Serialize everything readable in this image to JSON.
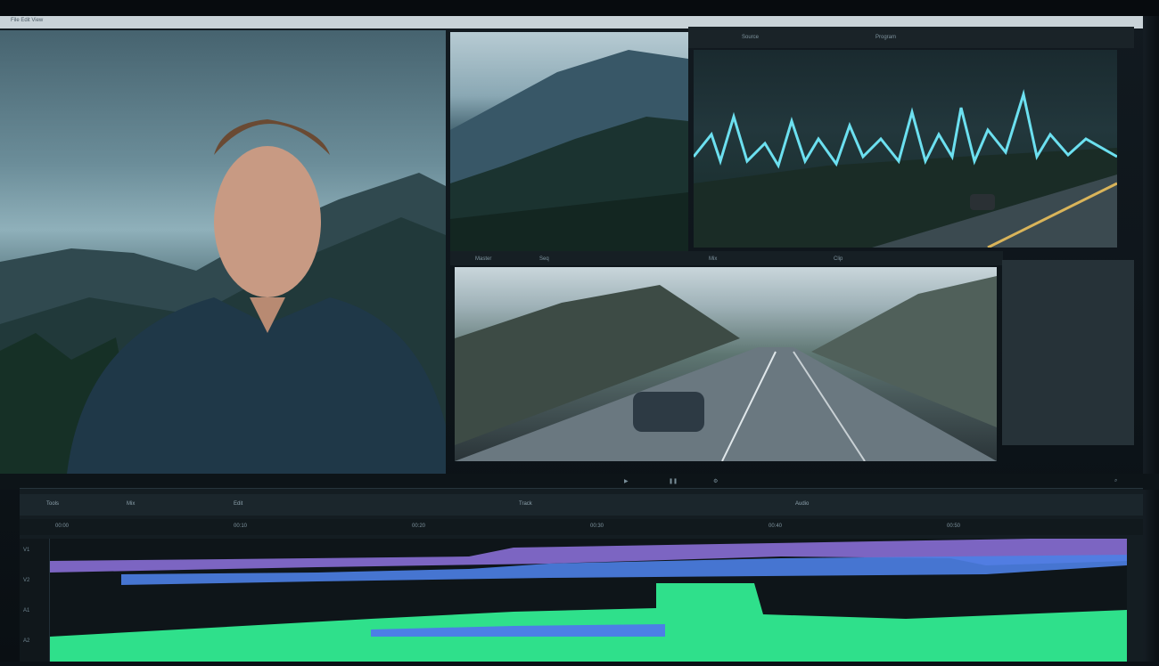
{
  "menubar": {
    "left_text": "File  Edit  View",
    "right_text": ""
  },
  "viewer_tabs": {
    "wave_panel": [
      "Source",
      "Program"
    ],
    "labels": [
      "Master",
      "Seq",
      "Mix",
      "Clip"
    ]
  },
  "timeline": {
    "toolbar": [
      "Tools",
      "Mix",
      "Edit",
      "Track",
      "Audio"
    ],
    "ruler": [
      "00:00",
      "00:10",
      "00:20",
      "00:30",
      "00:40",
      "00:50"
    ],
    "track_labels": [
      "V1",
      "V2",
      "A1",
      "A2"
    ]
  },
  "accent_colors": {
    "waveform": "#6ce0f0",
    "track_purple": "#8f73e0",
    "track_blue": "#4c7fe6",
    "track_green": "#2fe08b"
  },
  "icons": [
    "play-icon",
    "pause-icon",
    "settings-icon",
    "zoom-icon"
  ]
}
